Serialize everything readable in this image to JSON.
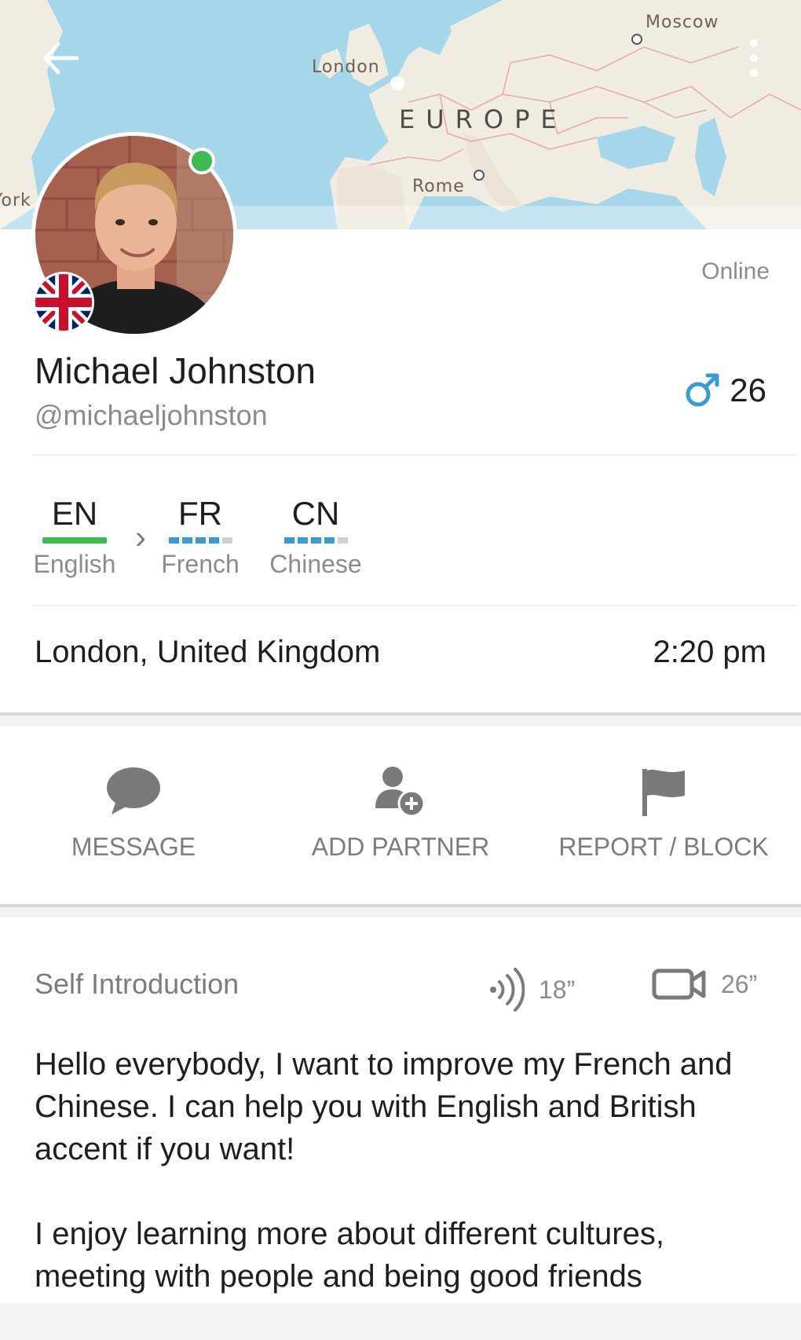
{
  "map": {
    "labels": {
      "moscow": "Moscow",
      "london": "London",
      "europe": "EUROPE",
      "rome": "Rome",
      "york": "York"
    },
    "water_color": "#a6d6ea",
    "land_color": "#f1ece2"
  },
  "header": {
    "back_icon": "arrow-left-icon",
    "more_icon": "more-vert-icon"
  },
  "profile": {
    "status": "Online",
    "name": "Michael Johnston",
    "handle": "@michaeljohnston",
    "gender_icon": "male-icon",
    "age": "26",
    "flag": "united-kingdom-flag",
    "online_color": "#3dbb4e"
  },
  "languages": {
    "native": {
      "code": "EN",
      "name": "English"
    },
    "learning": [
      {
        "code": "FR",
        "name": "French",
        "level": 4,
        "max": 5
      },
      {
        "code": "CN",
        "name": "Chinese",
        "level": 4,
        "max": 5
      }
    ],
    "accent_color": "#3a9bcf"
  },
  "location": {
    "place": "London, United Kingdom",
    "local_time": "2:20 pm"
  },
  "actions": {
    "message": "MESSAGE",
    "add_partner": "ADD PARTNER",
    "report_block": "REPORT / BLOCK"
  },
  "intro": {
    "title": "Self Introduction",
    "audio_duration": "18”",
    "video_duration": "26”",
    "paragraph1": "Hello everybody, I want to improve my French and Chinese. I can help you with English and British accent if you want!",
    "paragraph2": "I enjoy learning more about different cultures, meeting with people and being good friends"
  }
}
